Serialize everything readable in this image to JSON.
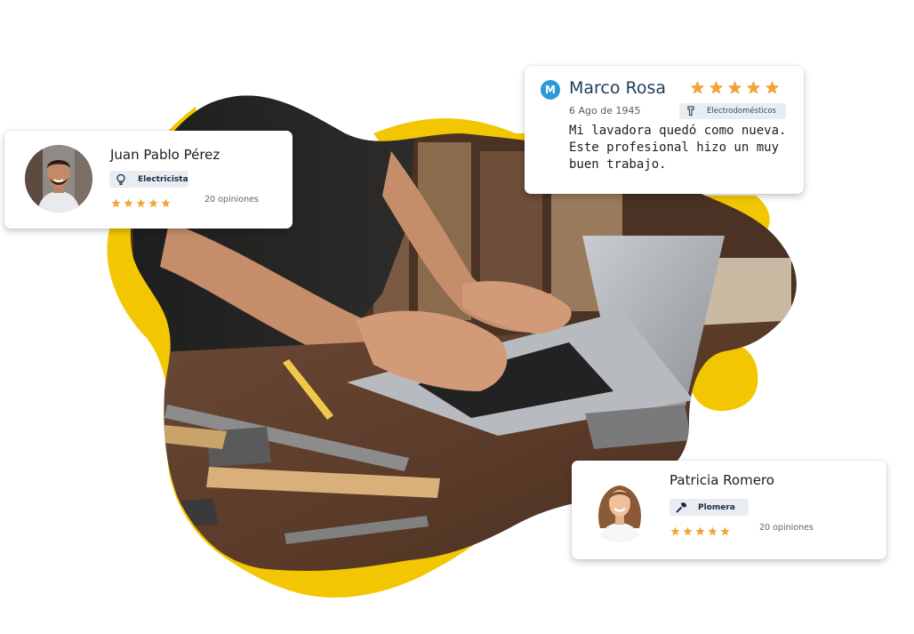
{
  "reviewer_cards": [
    {
      "name": "Juan Pablo Pérez",
      "category": "Electricista",
      "category_icon": "lightbulb-icon",
      "rating_stars": 5,
      "reviews_count": "20 opiniones"
    },
    {
      "name": "Patricia Romero",
      "category": "Plomera",
      "category_icon": "wrench-icon",
      "rating_stars": 5,
      "reviews_count": "20 opiniones"
    }
  ],
  "review": {
    "avatar_letter": "M",
    "name": "Marco Rosa",
    "date": "6 Ago de 1945",
    "category": "Electrodomésticos",
    "category_icon": "appliance-icon",
    "rating_stars": 5,
    "text": "Mi lavadora quedó como nueva. Este profesional hizo un muy buen trabajo."
  },
  "colors": {
    "blob_yellow": "#f2c600",
    "star": "#f0a43a",
    "badge_bg": "#e8edf2",
    "avatar_blue": "#2a9bd6",
    "name_blue": "#1d3c5a"
  },
  "background_photo": "hands typing on a laptop on a wooden workbench with hammers, pencil and tools"
}
